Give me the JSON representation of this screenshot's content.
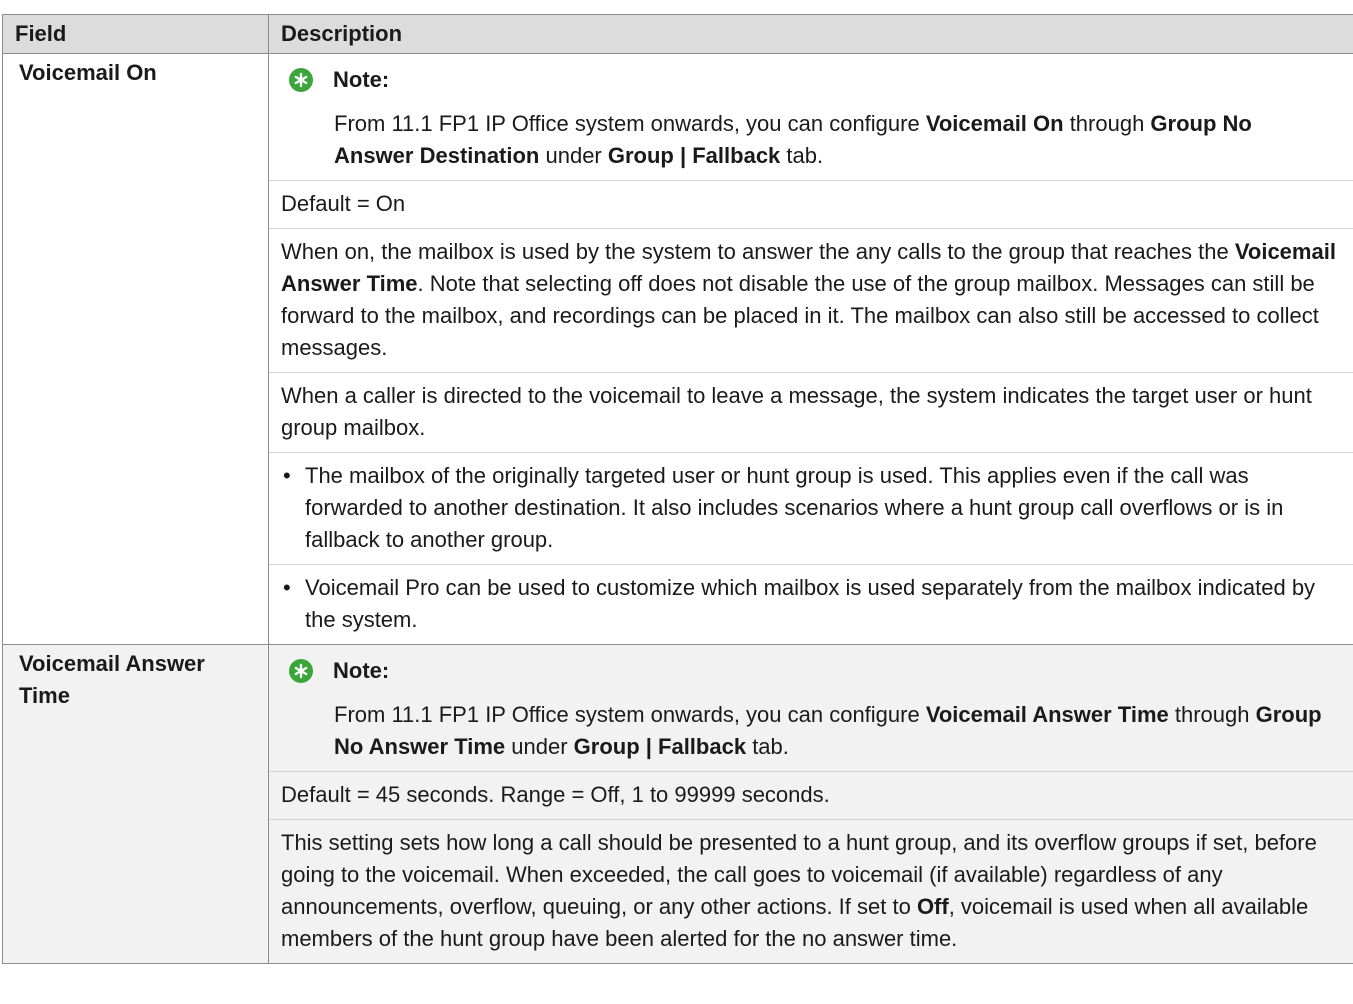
{
  "table": {
    "headers": {
      "field": "Field",
      "description": "Description"
    },
    "rows": [
      {
        "field": "Voicemail On",
        "note_label": "Note:",
        "note": {
          "p1": "From 11.1 FP1 IP Office system onwards, you can configure ",
          "b1": "Voicemail On",
          "p2": " through ",
          "b2": "Group No Answer Destination",
          "p3": " under ",
          "b3": "Group | Fallback",
          "p4": " tab."
        },
        "default": "Default = On",
        "para1": {
          "p1": "When on, the mailbox is used by the system to answer the any calls to the group that reaches the ",
          "b1": "Voicemail Answer Time",
          "p2": ". Note that selecting off does not disable the use of the group mailbox. Messages can still be forward to the mailbox, and recordings can be placed in it. The mailbox can also still be accessed to collect messages."
        },
        "para2": "When a caller is directed to the voicemail to leave a message, the system indicates the target user or hunt group mailbox.",
        "bullet_char": "•",
        "bullets": [
          "The mailbox of the originally targeted user or hunt group is used. This applies even if the call was forwarded to another destination. It also includes scenarios where a hunt group call overflows or is in fallback to another group.",
          "Voicemail Pro can be used to customize which mailbox is used separately from the mailbox indicated by the system."
        ]
      },
      {
        "field": "Voicemail Answer Time",
        "note_label": "Note:",
        "note": {
          "p1": "From 11.1 FP1 IP Office system onwards, you can configure ",
          "b1": "Voicemail Answer Time",
          "p2": " through ",
          "b2": "Group No Answer Time",
          "p3": " under ",
          "b3": "Group | Fallback",
          "p4": " tab."
        },
        "default": "Default = 45 seconds. Range = Off, 1 to 99999 seconds.",
        "para1": {
          "p1": "This setting sets how long a call should be presented to a hunt group, and its overflow groups if set, before going to the voicemail. When exceeded, the call goes to voicemail (if available) regardless of any announcements, overflow, queuing, or any other actions. If set to ",
          "b1": "Off",
          "p2": ", voicemail is used when all available members of the hunt group have been alerted for the no answer time."
        }
      }
    ]
  },
  "colors": {
    "header_bg": "#dcdcdc",
    "shaded_row_bg": "#f2f2f2",
    "note_icon": "#3aa63a",
    "border": "#8c8c8c"
  },
  "icons": {
    "note": "asterisk-icon"
  }
}
